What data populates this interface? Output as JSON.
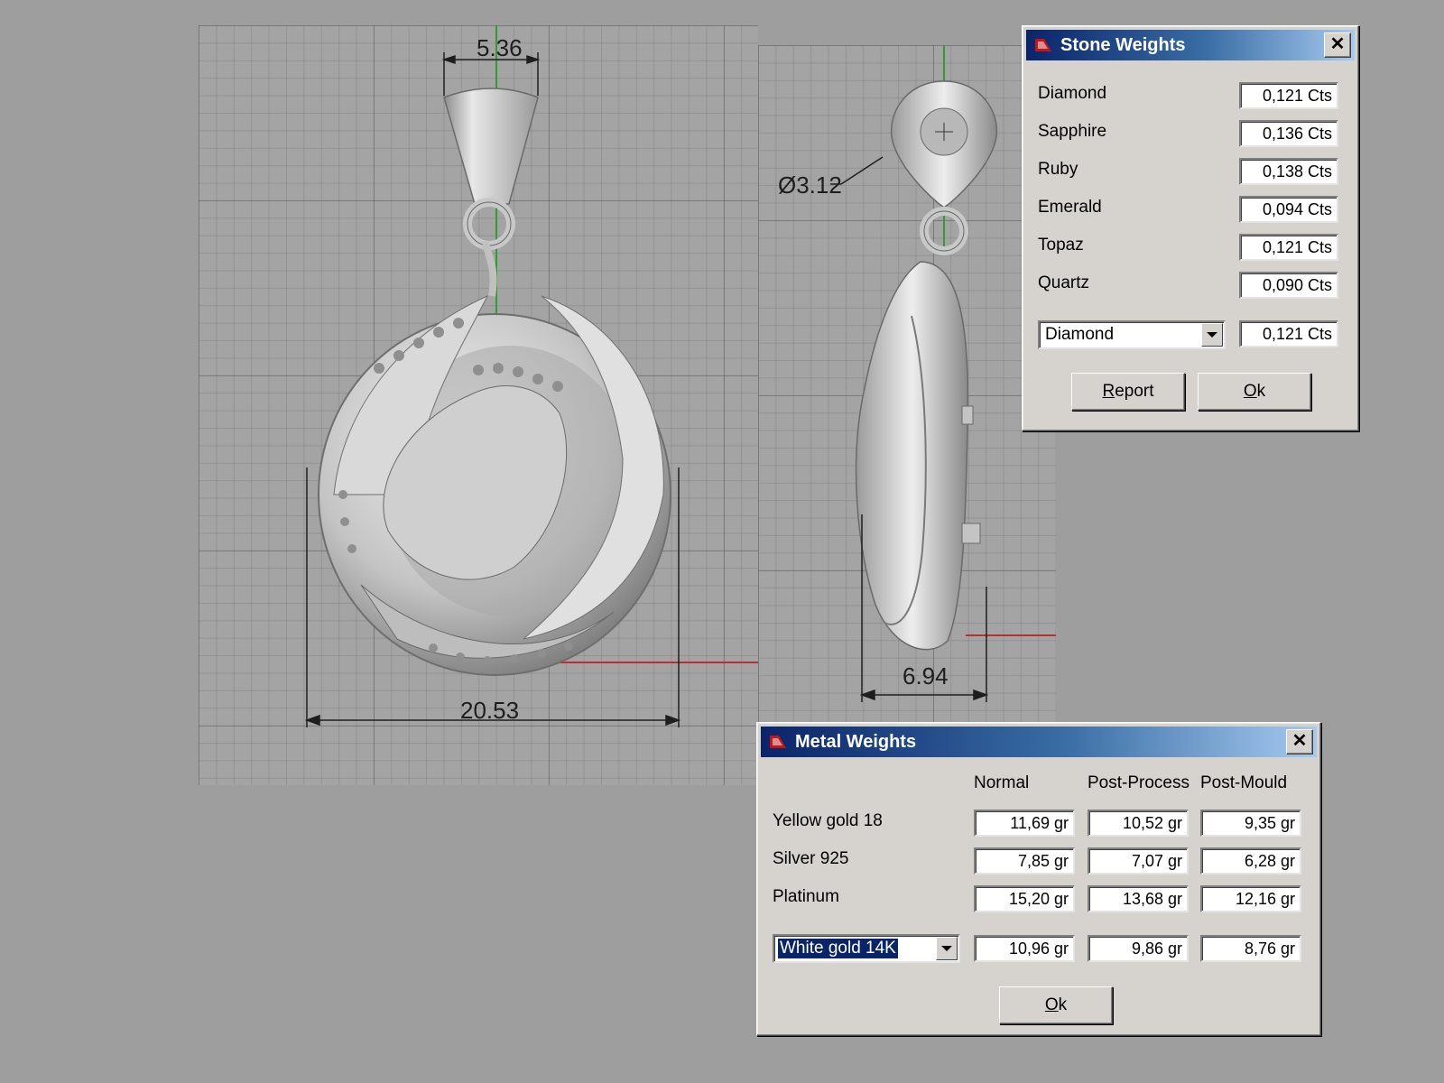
{
  "front_view": {
    "dim_top": "5.36",
    "dim_width": "20.53"
  },
  "side_view": {
    "dim_diameter": "Ø3.12",
    "dim_depth": "6.94"
  },
  "stone_weights": {
    "title": "Stone Weights",
    "close_glyph": "✕",
    "rows": [
      {
        "label": "Diamond",
        "value": "0,121 Cts"
      },
      {
        "label": "Sapphire",
        "value": "0,136 Cts"
      },
      {
        "label": "Ruby",
        "value": "0,138 Cts"
      },
      {
        "label": "Emerald",
        "value": "0,094 Cts"
      },
      {
        "label": "Topaz",
        "value": "0,121 Cts"
      },
      {
        "label": "Quartz",
        "value": "0,090 Cts"
      }
    ],
    "select_value": "Diamond",
    "select_result": "0,121 Cts",
    "report_mnemonic": "R",
    "report_rest": "eport",
    "ok_mnemonic": "O",
    "ok_rest": "k"
  },
  "metal_weights": {
    "title": "Metal Weights",
    "close_glyph": "✕",
    "columns": [
      "Normal",
      "Post-Process",
      "Post-Mould"
    ],
    "rows": [
      {
        "label": "Yellow gold 18",
        "normal": "11,69 gr",
        "post_process": "10,52 gr",
        "post_mould": "9,35 gr"
      },
      {
        "label": "Silver 925",
        "normal": "7,85 gr",
        "post_process": "7,07 gr",
        "post_mould": "6,28 gr"
      },
      {
        "label": "Platinum",
        "normal": "15,20 gr",
        "post_process": "13,68 gr",
        "post_mould": "12,16 gr"
      }
    ],
    "select_value": "White gold 14K",
    "select_normal": "10,96 gr",
    "select_post_process": "9,86 gr",
    "select_post_mould": "8,76 gr",
    "ok_mnemonic": "O",
    "ok_rest": "k"
  },
  "colors": {
    "background": "#9e9e9e",
    "titlebar_start": "#0a246a",
    "titlebar_end": "#a6caf0",
    "axis_green": "#2e9e2e",
    "axis_red": "#b83030"
  }
}
